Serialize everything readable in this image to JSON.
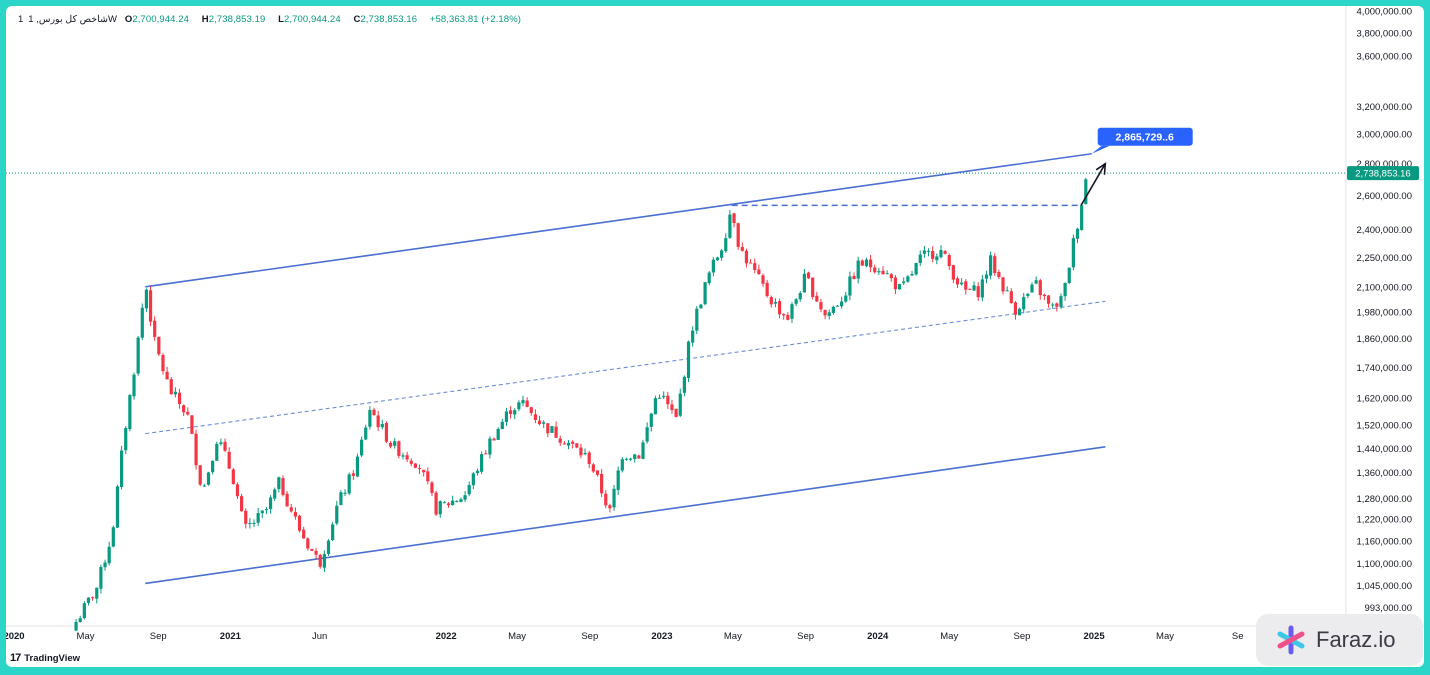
{
  "header": {
    "symbol": "شاخص کل بورس, 1W",
    "interval": "1",
    "open_label": "O",
    "open": "2,700,944.24",
    "high_label": "H",
    "high": "2,738,853.19",
    "low_label": "L",
    "low": "2,700,944.24",
    "close_label": "C",
    "close": "2,738,853.16",
    "change": "+58,363.81 (+2.18%)"
  },
  "branding": {
    "tradingview": "TradingView",
    "watermark": "Faraz.io"
  },
  "colors": {
    "up": "#089981",
    "down": "#f23645",
    "channel": "#4a6fd1",
    "price_label": "#089981",
    "target_label": "#2962ff"
  },
  "chart_data": {
    "type": "candlestick",
    "title": "",
    "y_scale": "log",
    "ylim": [
      980000,
      4000000
    ],
    "x_range": [
      "2020-01-01",
      "2025-09-15"
    ],
    "y_ticks": [
      993000,
      1045000,
      1100000,
      1160000,
      1220000,
      1280000,
      1360000,
      1440000,
      1520000,
      1620000,
      1740000,
      1860000,
      1980000,
      2100000,
      2250000,
      2400000,
      2600000,
      2800000,
      3000000,
      3200000,
      3600000,
      3800000,
      4000000
    ],
    "y_tick_labels": [
      "993,000.00",
      "1,045,000.00",
      "1,100,000.00",
      "1,160,000.00",
      "1,220,000.00",
      "1,280,000.00",
      "1,360,000.00",
      "1,440,000.00",
      "1,520,000.00",
      "1,620,000.00",
      "1,740,000.00",
      "1,860,000.00",
      "1,980,000.00",
      "2,100,000.00",
      "2,250,000.00",
      "2,400,000.00",
      "2,600,000.00",
      "2,800,000.00",
      "3,000,000.00",
      "3,200,000.00",
      "3,600,000.00",
      "3,800,000.00",
      "4,000,000.00"
    ],
    "x_ticks": [
      {
        "date": "2020-01-01",
        "label": "2020",
        "bold": true
      },
      {
        "date": "2020-05-01",
        "label": "May",
        "bold": false
      },
      {
        "date": "2020-09-01",
        "label": "Sep",
        "bold": false
      },
      {
        "date": "2021-01-01",
        "label": "2021",
        "bold": true
      },
      {
        "date": "2021-06-01",
        "label": "Jun",
        "bold": false
      },
      {
        "date": "2022-01-01",
        "label": "2022",
        "bold": true
      },
      {
        "date": "2022-05-01",
        "label": "May",
        "bold": false
      },
      {
        "date": "2022-09-01",
        "label": "Sep",
        "bold": false
      },
      {
        "date": "2023-01-01",
        "label": "2023",
        "bold": true
      },
      {
        "date": "2023-05-01",
        "label": "May",
        "bold": false
      },
      {
        "date": "2023-09-01",
        "label": "Sep",
        "bold": false
      },
      {
        "date": "2024-01-01",
        "label": "2024",
        "bold": true
      },
      {
        "date": "2024-05-01",
        "label": "May",
        "bold": false
      },
      {
        "date": "2024-09-01",
        "label": "Sep",
        "bold": false
      },
      {
        "date": "2025-01-01",
        "label": "2025",
        "bold": true
      },
      {
        "date": "2025-05-01",
        "label": "May",
        "bold": false
      },
      {
        "date": "2025-09-01",
        "label": "Se",
        "bold": false
      }
    ],
    "price_path": [
      [
        "2020-04-15",
        960000
      ],
      [
        "2020-05-20",
        1040000
      ],
      [
        "2020-06-15",
        1180000
      ],
      [
        "2020-07-05",
        1480000
      ],
      [
        "2020-07-25",
        1780000
      ],
      [
        "2020-08-05",
        2000000
      ],
      [
        "2020-08-12",
        2090000
      ],
      [
        "2020-08-25",
        1850000
      ],
      [
        "2020-09-20",
        1650000
      ],
      [
        "2020-10-20",
        1560000
      ],
      [
        "2020-11-15",
        1300000
      ],
      [
        "2020-12-10",
        1480000
      ],
      [
        "2021-01-05",
        1350000
      ],
      [
        "2021-01-25",
        1190000
      ],
      [
        "2021-03-01",
        1240000
      ],
      [
        "2021-03-25",
        1330000
      ],
      [
        "2021-05-01",
        1180000
      ],
      [
        "2021-06-01",
        1100000
      ],
      [
        "2021-07-01",
        1260000
      ],
      [
        "2021-08-01",
        1380000
      ],
      [
        "2021-08-25",
        1580000
      ],
      [
        "2021-10-01",
        1450000
      ],
      [
        "2021-11-15",
        1390000
      ],
      [
        "2021-12-15",
        1250000
      ],
      [
        "2022-02-01",
        1290000
      ],
      [
        "2022-03-15",
        1460000
      ],
      [
        "2022-04-20",
        1580000
      ],
      [
        "2022-05-10",
        1600000
      ],
      [
        "2022-06-15",
        1520000
      ],
      [
        "2022-07-20",
        1470000
      ],
      [
        "2022-09-01",
        1400000
      ],
      [
        "2022-10-05",
        1240000
      ],
      [
        "2022-10-25",
        1420000
      ],
      [
        "2022-11-25",
        1420000
      ],
      [
        "2022-12-25",
        1650000
      ],
      [
        "2023-01-25",
        1540000
      ],
      [
        "2023-02-20",
        1900000
      ],
      [
        "2023-03-20",
        2150000
      ],
      [
        "2023-04-15",
        2330000
      ],
      [
        "2023-04-29",
        2540000
      ],
      [
        "2023-05-12",
        2300000
      ],
      [
        "2023-06-01",
        2200000
      ],
      [
        "2023-07-01",
        2050000
      ],
      [
        "2023-08-01",
        1950000
      ],
      [
        "2023-09-01",
        2150000
      ],
      [
        "2023-10-05",
        1960000
      ],
      [
        "2023-11-05",
        2060000
      ],
      [
        "2023-12-01",
        2220000
      ],
      [
        "2024-01-05",
        2200000
      ],
      [
        "2024-02-10",
        2080000
      ],
      [
        "2024-03-15",
        2250000
      ],
      [
        "2024-04-15",
        2290000
      ],
      [
        "2024-05-25",
        2080000
      ],
      [
        "2024-06-20",
        2080000
      ],
      [
        "2024-07-10",
        2230000
      ],
      [
        "2024-08-20",
        1990000
      ],
      [
        "2024-09-25",
        2110000
      ],
      [
        "2024-10-20",
        1990000
      ],
      [
        "2024-11-10",
        2050000
      ],
      [
        "2024-11-25",
        2300000
      ],
      [
        "2024-12-08",
        2500000
      ],
      [
        "2024-12-20",
        2738853
      ]
    ],
    "annotations": {
      "channel_upper": [
        [
          "2020-08-10",
          2100000
        ],
        [
          "2024-12-28",
          2865729
        ]
      ],
      "channel_lower": [
        [
          "2020-08-10",
          1050000
        ],
        [
          "2025-01-20",
          1445000
        ]
      ],
      "channel_mid": [
        [
          "2020-08-10",
          1490000
        ],
        [
          "2025-01-20",
          2030000
        ]
      ],
      "horizontal_level": [
        [
          "2023-04-29",
          2540000
        ],
        [
          "2024-12-10",
          2540000
        ]
      ],
      "arrow": [
        [
          "2024-12-10",
          2540000
        ],
        [
          "2025-01-20",
          2800000
        ]
      ],
      "target_value": 2865729,
      "target_label": "2,865,729..6",
      "current_price": 2738853.16,
      "current_price_label": "2,738,853.16"
    }
  }
}
